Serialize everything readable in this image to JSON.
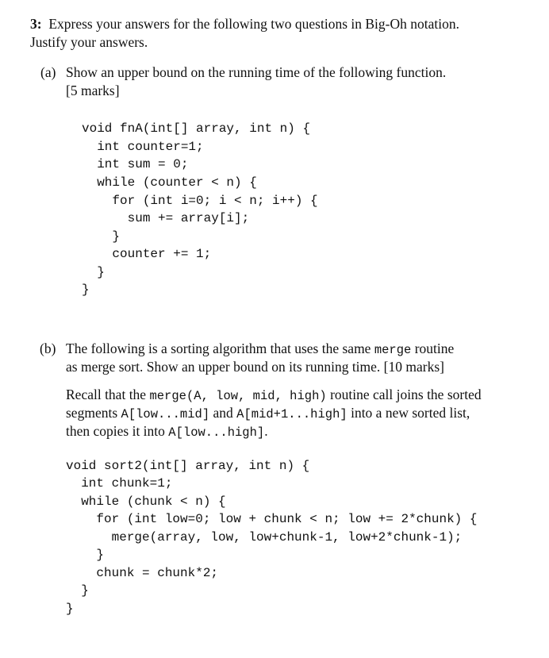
{
  "question": {
    "number": "3:",
    "intro_line1": "Express your answers for the following two questions in Big-Oh notation.",
    "intro_line2": "Justify your answers."
  },
  "part_a": {
    "label": "(a)",
    "text_line1": "Show an upper bound on the running time of the following function.",
    "marks": "[5 marks]",
    "code": [
      "void fnA(int[] array, int n) {",
      "  int counter=1;",
      "  int sum = 0;",
      "  while (counter < n) {",
      "    for (int i=0; i < n; i++) {",
      "      sum += array[i];",
      "    }",
      "    counter += 1;",
      "  }",
      "}"
    ]
  },
  "part_b": {
    "label": "(b)",
    "text_line1_pre": "The following is a sorting algorithm that uses the same ",
    "text_line1_code": "merge",
    "text_line1_post": " routine",
    "text_line2": "as merge sort. Show an upper bound on its running time. [10 marks]",
    "recall_line1_pre": "Recall that the ",
    "recall_line1_code": "merge(A, low, mid, high)",
    "recall_line1_post": " routine call joins the sorted",
    "recall_line2_pre": "segments ",
    "recall_line2_code1": "A[low...mid]",
    "recall_line2_mid": " and ",
    "recall_line2_code2": "A[mid+1...high]",
    "recall_line2_post": " into a new sorted list,",
    "recall_line3_pre": "then copies it into ",
    "recall_line3_code": "A[low...high]",
    "recall_line3_post": ".",
    "code": [
      "void sort2(int[] array, int n) {",
      "  int chunk=1;",
      "  while (chunk < n) {",
      "    for (int low=0; low + chunk < n; low += 2*chunk) {",
      "      merge(array, low, low+chunk-1, low+2*chunk-1);",
      "    }",
      "    chunk = chunk*2;",
      "  }",
      "}"
    ]
  }
}
